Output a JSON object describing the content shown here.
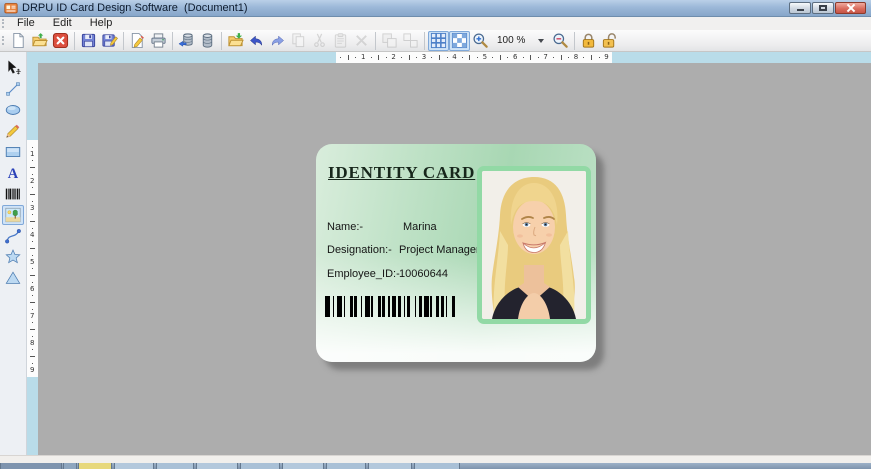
{
  "window": {
    "title": "DRPU ID Card Design Software  (Document1)",
    "controls": [
      "minimize",
      "maximize",
      "close"
    ]
  },
  "menu": {
    "items": [
      "File",
      "Edit",
      "Help"
    ]
  },
  "toolbar": {
    "zoom_level": "100 %",
    "buttons": [
      {
        "name": "new-document",
        "state": "normal"
      },
      {
        "name": "open",
        "state": "normal"
      },
      {
        "name": "close-document",
        "state": "normal"
      },
      {
        "name": "separator"
      },
      {
        "name": "save",
        "state": "normal"
      },
      {
        "name": "save-as",
        "state": "normal"
      },
      {
        "name": "separator"
      },
      {
        "name": "edit-card",
        "state": "normal"
      },
      {
        "name": "print",
        "state": "normal"
      },
      {
        "name": "separator"
      },
      {
        "name": "database-add",
        "state": "normal"
      },
      {
        "name": "database",
        "state": "normal"
      },
      {
        "name": "separator"
      },
      {
        "name": "export-folder",
        "state": "normal"
      },
      {
        "name": "undo",
        "state": "normal"
      },
      {
        "name": "redo",
        "state": "normal"
      },
      {
        "name": "copy",
        "state": "disabled"
      },
      {
        "name": "cut",
        "state": "disabled"
      },
      {
        "name": "paste",
        "state": "disabled"
      },
      {
        "name": "delete",
        "state": "disabled"
      },
      {
        "name": "separator"
      },
      {
        "name": "group",
        "state": "disabled"
      },
      {
        "name": "ungroup",
        "state": "disabled"
      },
      {
        "name": "separator"
      },
      {
        "name": "show-grid",
        "state": "selected"
      },
      {
        "name": "snap-grid",
        "state": "selected"
      },
      {
        "name": "zoom-in",
        "state": "normal"
      },
      {
        "name": "zoom-combo",
        "state": "normal"
      },
      {
        "name": "zoom-out",
        "state": "normal"
      },
      {
        "name": "separator"
      },
      {
        "name": "lock",
        "state": "normal"
      },
      {
        "name": "unlock",
        "state": "normal"
      }
    ]
  },
  "tool_panel": {
    "tools": [
      {
        "name": "select-move",
        "selected": false
      },
      {
        "name": "line",
        "selected": false
      },
      {
        "name": "ellipse",
        "selected": false
      },
      {
        "name": "pencil",
        "selected": false
      },
      {
        "name": "rectangle",
        "selected": false
      },
      {
        "name": "text",
        "selected": false
      },
      {
        "name": "barcode",
        "selected": false
      },
      {
        "name": "image",
        "selected": true
      },
      {
        "name": "curve",
        "selected": false
      },
      {
        "name": "star",
        "selected": false
      },
      {
        "name": "triangle",
        "selected": false
      }
    ]
  },
  "rulers": {
    "horizontal_numbers": [
      1,
      2,
      3,
      4,
      5,
      6,
      7,
      8,
      9
    ],
    "vertical_numbers": [
      1,
      2,
      3,
      4,
      5,
      6,
      7,
      8,
      9
    ]
  },
  "card": {
    "title": "IDENTITY CARD",
    "fields": [
      {
        "label": "Name:-",
        "value": "Marina"
      },
      {
        "label": "Designation:-",
        "value": "Project Manager"
      },
      {
        "label": "Employee_ID:-",
        "value": "10060644"
      }
    ],
    "barcode_pattern": "32123113212212311321221131221123122131132121132",
    "photo": "woman-portrait-photo"
  },
  "colors": {
    "titlebar_blue": "#9cb8d8",
    "ruler_blue": "#b9dce9",
    "canvas_gray": "#adadad",
    "card_green": "#a8d7b3",
    "card_green_light": "#d9eddc",
    "photo_frame_green": "#92d9a5",
    "selection_blue": "#cfe3f7"
  }
}
